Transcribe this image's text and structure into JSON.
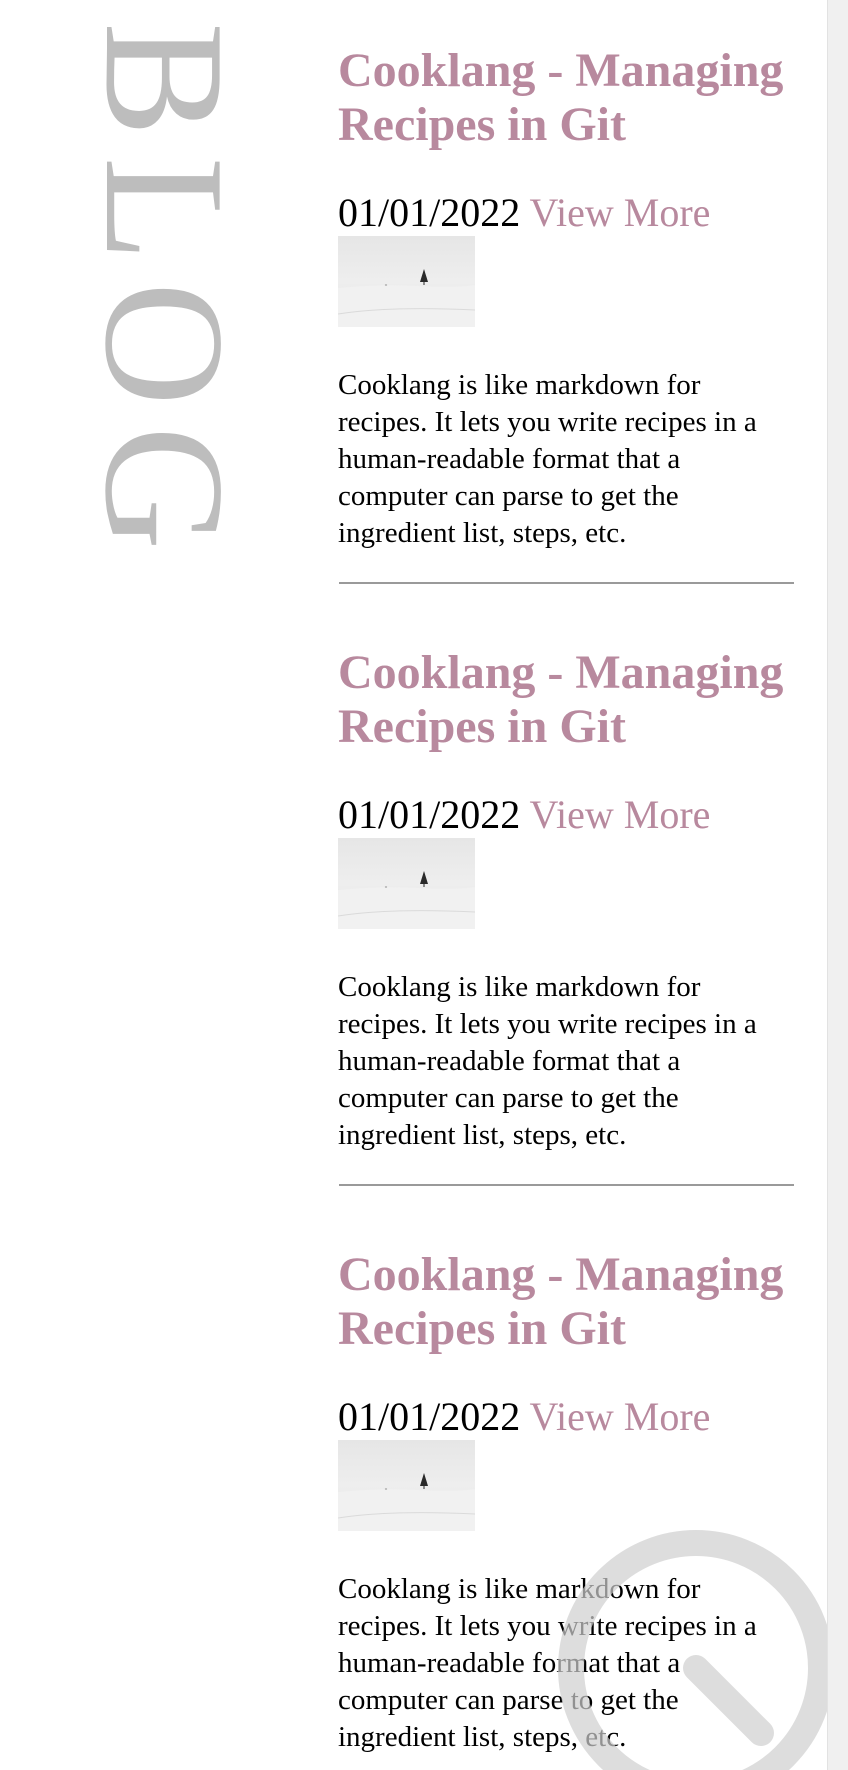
{
  "sidebar": {
    "title": "BLOG"
  },
  "posts": [
    {
      "title": "Cooklang - Managing Recipes in Git",
      "date": "01/01/2022",
      "view_more": "View More",
      "thumbnail_icon": "snowy-tree-thumbnail",
      "excerpt": "Cooklang is like markdown for recipes. It lets you write recipes in a human-readable format that a computer can parse to get the ingredient list, steps, etc."
    },
    {
      "title": "Cooklang - Managing Recipes in Git",
      "date": "01/01/2022",
      "view_more": "View More",
      "thumbnail_icon": "snowy-tree-thumbnail",
      "excerpt": "Cooklang is like markdown for recipes. It lets you write recipes in a human-readable format that a computer can parse to get the ingredient list, steps, etc."
    },
    {
      "title": "Cooklang - Managing Recipes in Git",
      "date": "01/01/2022",
      "view_more": "View More",
      "thumbnail_icon": "snowy-tree-thumbnail",
      "excerpt": "Cooklang is like markdown for recipes. It lets you write recipes in a human-readable format that a computer can parse to get the ingredient list, steps, etc."
    }
  ],
  "floating_button": {
    "icon": "search-icon"
  },
  "colors": {
    "accent": "#b8899e",
    "sidebar_text": "#bdbdbd",
    "body_text": "#000000",
    "divider": "#9a9a9a"
  }
}
